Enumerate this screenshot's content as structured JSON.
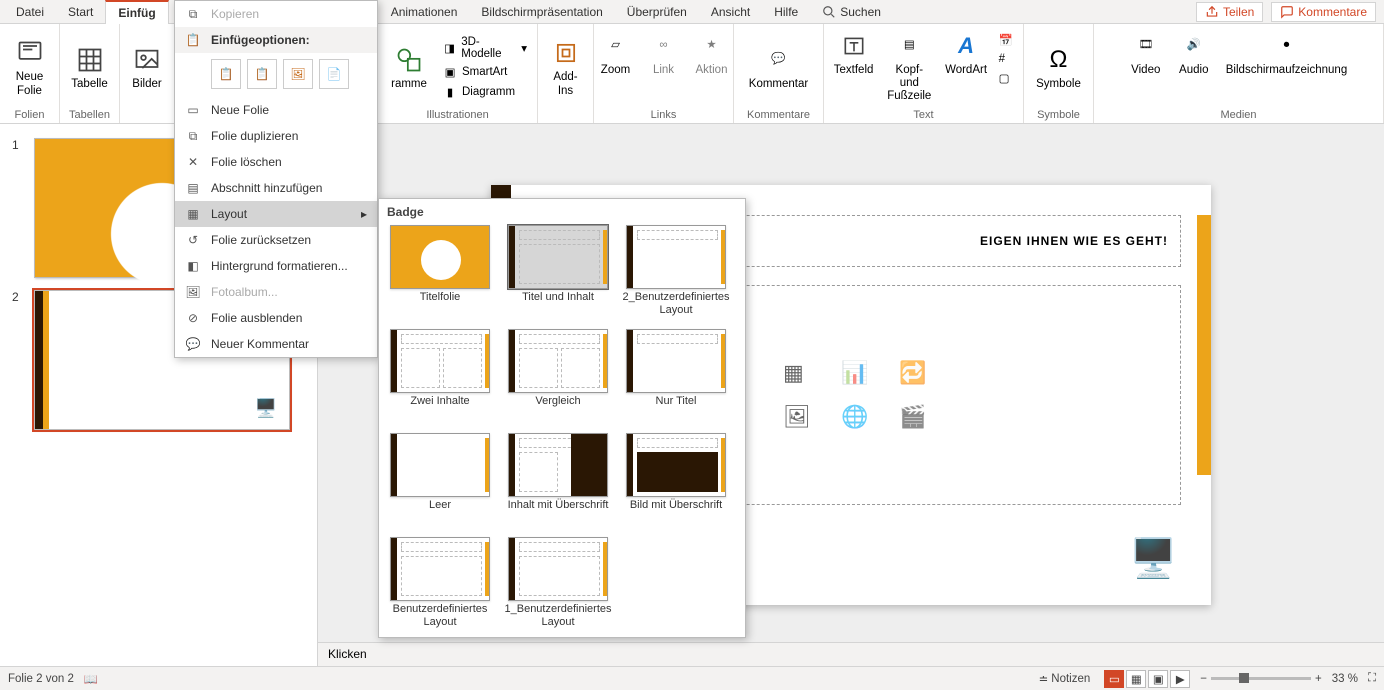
{
  "tabs": {
    "items": [
      "Datei",
      "Start",
      "Einfüg",
      "Animationen",
      "Bildschirmpräsentation",
      "Überprüfen",
      "Ansicht",
      "Hilfe"
    ],
    "active_index": 2,
    "search_label": "Suchen"
  },
  "top_right": {
    "share": "Teilen",
    "comments": "Kommentare"
  },
  "ribbon": {
    "groups": {
      "folien": {
        "label": "Folien",
        "new_slide": "Neue\nFolie"
      },
      "tabellen": {
        "label": "Tabellen",
        "table": "Tabelle"
      },
      "bilder_grp": {
        "bilder": "Bilder"
      },
      "illustrationen": {
        "label": "Illustrationen",
        "programme": "ramme",
        "models": "3D-Modelle",
        "smartart": "SmartArt",
        "diagramm": "Diagramm"
      },
      "addins": {
        "addins": "Add-\nIns"
      },
      "links": {
        "label": "Links",
        "zoom": "Zoom",
        "link": "Link",
        "aktion": "Aktion"
      },
      "kommentare": {
        "label": "Kommentare",
        "kommentar": "Kommentar"
      },
      "text": {
        "label": "Text",
        "textfeld": "Textfeld",
        "kopf": "Kopf- und\nFußzeile",
        "wordart": "WordArt"
      },
      "symbole": {
        "label": "Symbole",
        "symbole": "Symbole"
      },
      "medien": {
        "label": "Medien",
        "video": "Video",
        "audio": "Audio",
        "screen": "Bildschirmaufzeichnung"
      }
    }
  },
  "context_menu": {
    "copy": "Kopieren",
    "paste_header": "Einfügeoptionen:",
    "new_slide": "Neue Folie",
    "dup_slide": "Folie duplizieren",
    "del_slide": "Folie löschen",
    "add_section": "Abschnitt hinzufügen",
    "layout": "Layout",
    "reset_slide": "Folie zurücksetzen",
    "format_bg": "Hintergrund formatieren...",
    "photo_album": "Fotoalbum...",
    "hide_slide": "Folie ausblenden",
    "new_comment": "Neuer Kommentar"
  },
  "layout_gallery": {
    "header": "Badge",
    "items": [
      "Titelfolie",
      "Titel und Inhalt",
      "2_Benutzerdefiniertes Layout",
      "Zwei Inhalte",
      "Vergleich",
      "Nur Titel",
      "Leer",
      "Inhalt mit Überschrift",
      "Bild mit Überschrift",
      "Benutzerdefiniertes Layout",
      "1_Benutzerdefiniertes Layout"
    ],
    "selected_index": 1
  },
  "slide": {
    "visible_title": "EIGEN IHNEN WIE ES GEHT!"
  },
  "click_bar": "Klicken",
  "status": {
    "slide_counter": "Folie 2 von 2",
    "notes": "Notizen",
    "zoom_percent": "33 %"
  },
  "thumbs": {
    "count": 2,
    "selected": 2
  },
  "colors": {
    "accent": "#d24726",
    "gold": "#eca41a"
  }
}
